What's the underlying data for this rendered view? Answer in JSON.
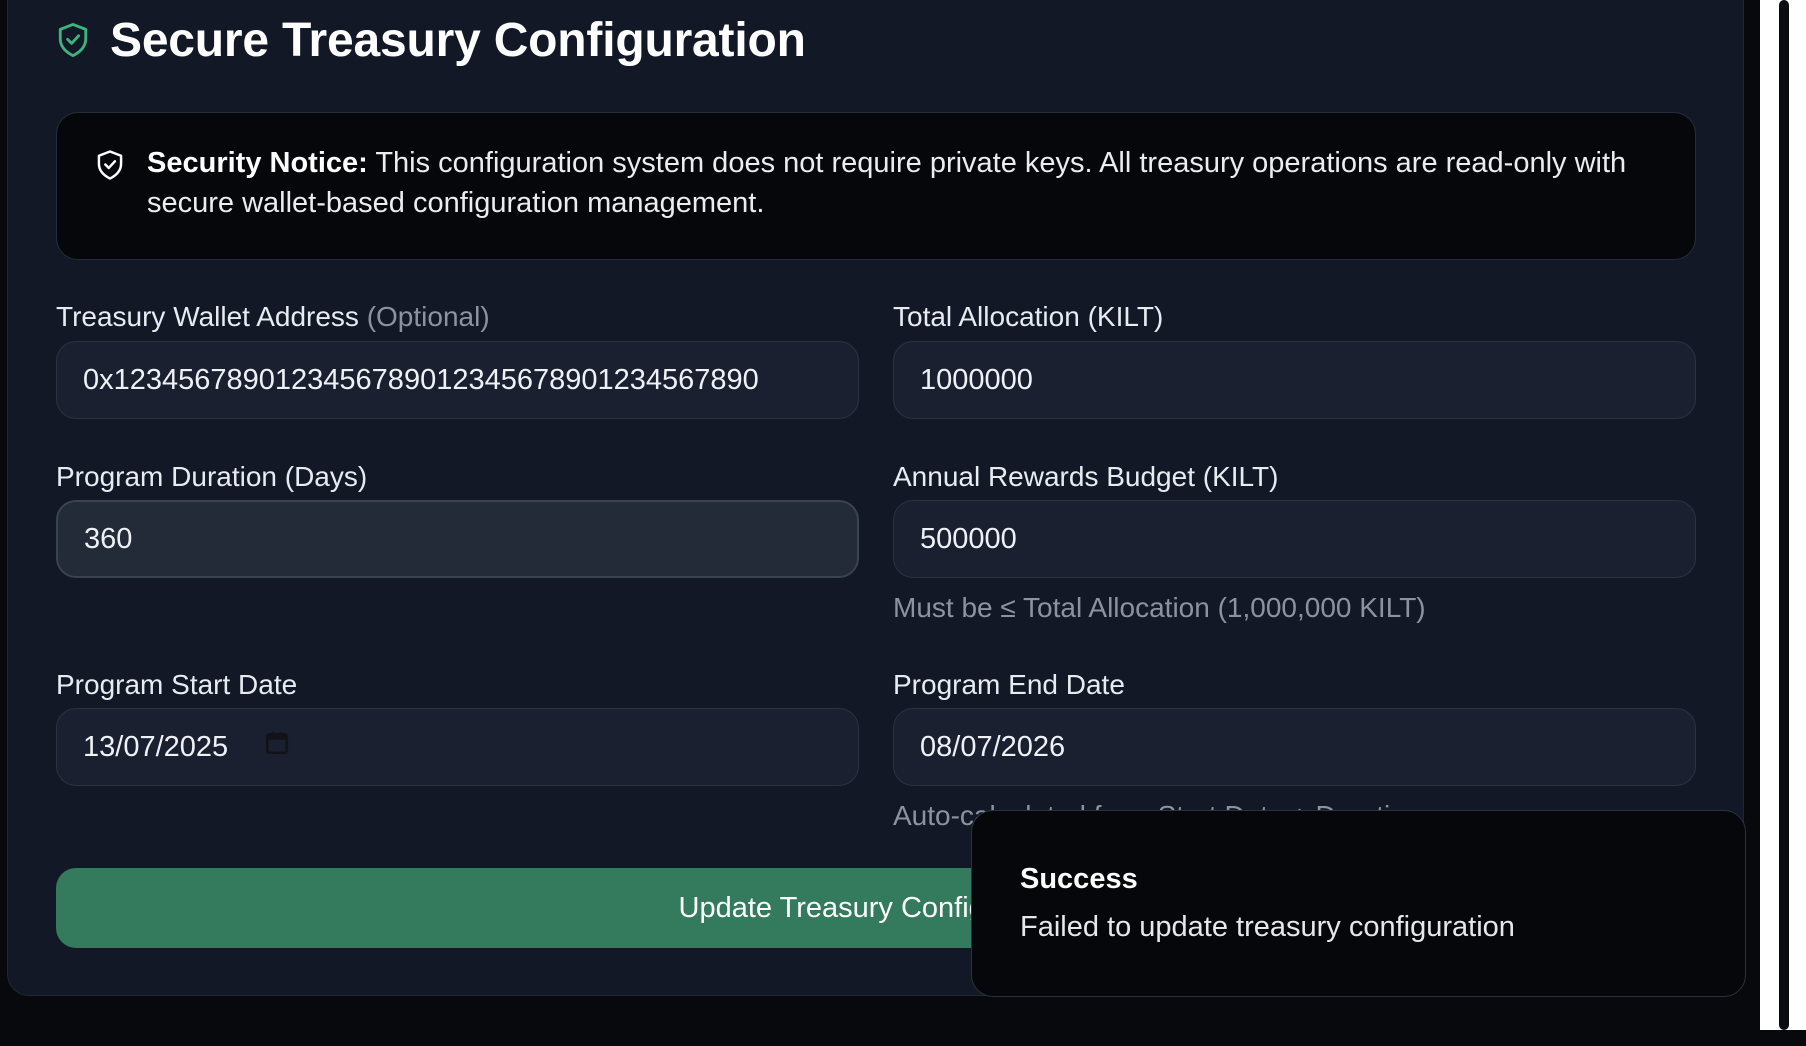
{
  "header": {
    "title": "Secure Treasury Configuration",
    "icon": "shield-check-icon",
    "icon_color": "#3fb37f"
  },
  "notice": {
    "icon": "shield-check-icon",
    "label": "Security Notice:",
    "text": " This configuration system does not require private keys. All treasury operations are read-only with secure wallet-based configuration management."
  },
  "form": {
    "wallet": {
      "label": "Treasury Wallet Address",
      "label_optional": "(Optional)",
      "value": "0x1234567890123456789012345678901234567890"
    },
    "total_allocation": {
      "label": "Total Allocation (KILT)",
      "value": "1000000"
    },
    "duration": {
      "label": "Program Duration (Days)",
      "value": "360"
    },
    "annual_budget": {
      "label": "Annual Rewards Budget (KILT)",
      "value": "500000",
      "hint": "Must be ≤ Total Allocation (1,000,000 KILT)"
    },
    "start_date": {
      "label": "Program Start Date",
      "value": "13/07/2025",
      "icon": "calendar-icon"
    },
    "end_date": {
      "label": "Program End Date",
      "value": "08/07/2026",
      "hint": "Auto-calculated from Start Date + Duration"
    },
    "submit_label": "Update Treasury Configuration"
  },
  "toast": {
    "title": "Success",
    "description": "Failed to update treasury configuration"
  },
  "colors": {
    "background": "#121826",
    "primary_button": "#347a5c",
    "accent": "#3fb37f"
  }
}
